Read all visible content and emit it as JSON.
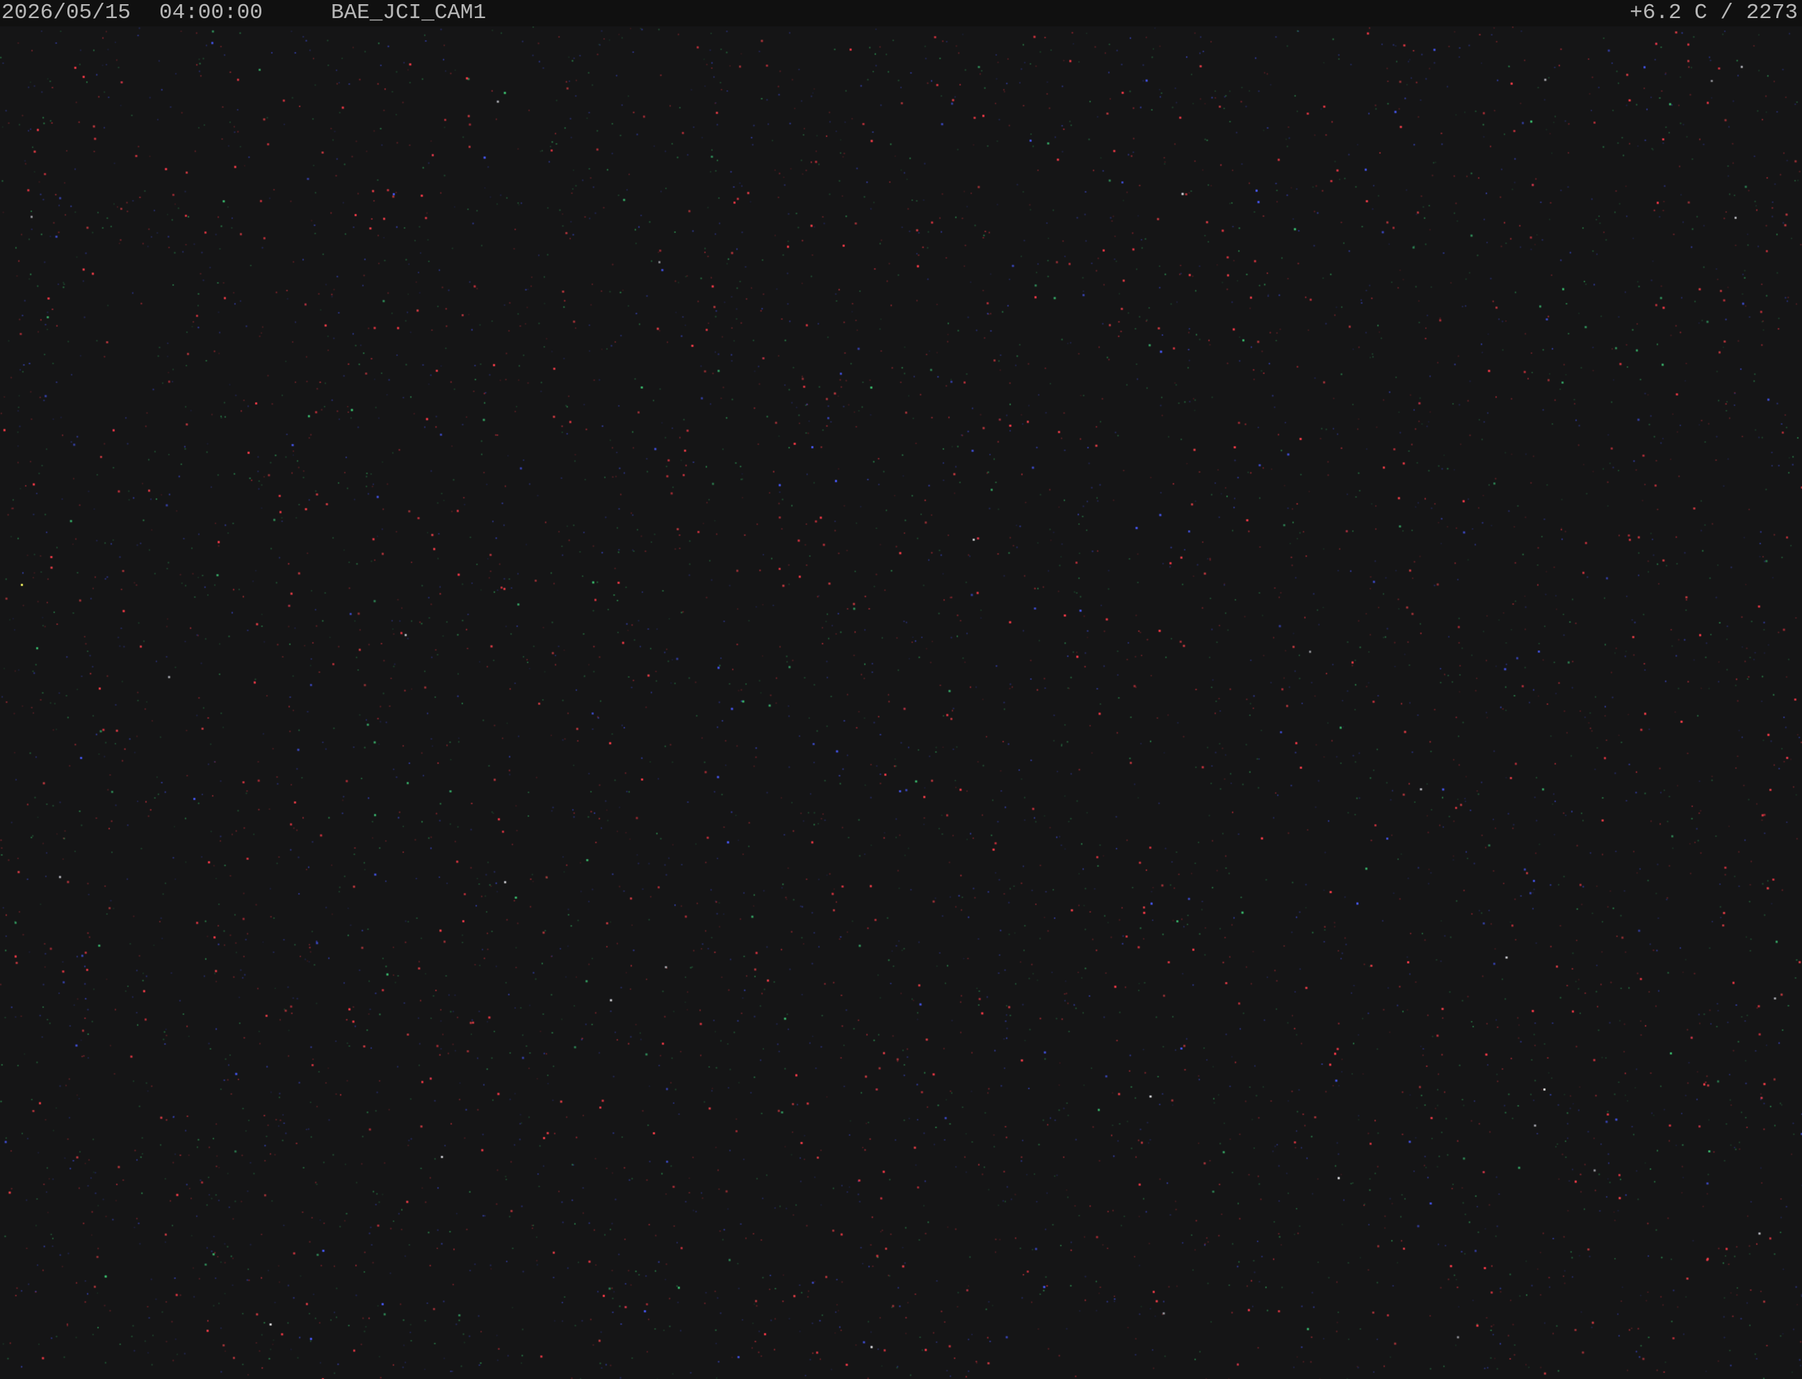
{
  "overlay": {
    "date": "2026/05/15",
    "time": "04:00:00",
    "camera_id": "BAE_JCI_CAM1",
    "status_readout": "+6.2 C / 2273"
  },
  "image": {
    "description_colors": {
      "background": "#151516",
      "overlay_bar": "#101010",
      "overlay_text": "#b8b8b8",
      "noise_colors": [
        "#ff3c4a",
        "#3cc86e",
        "#4a5cff",
        "#e8e8e8",
        "#f0f060"
      ]
    }
  }
}
